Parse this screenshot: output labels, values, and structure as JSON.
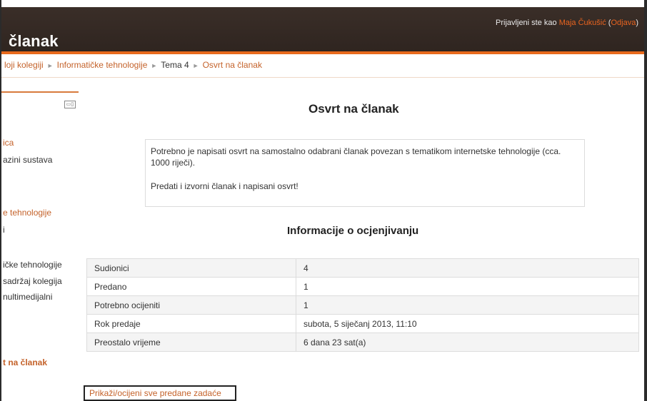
{
  "header": {
    "page_heading": "članak",
    "login_prefix": "Prijavljeni ste kao ",
    "user_name": "Maja Čukušić",
    "logout_open": " (",
    "logout_label": "Odjava",
    "logout_close": ")"
  },
  "breadcrumb": {
    "items": [
      {
        "label": "loji kolegiji"
      },
      {
        "label": "Informatičke tehnologije"
      },
      {
        "label": "Tema 4"
      },
      {
        "label": "Osvrt na članak"
      }
    ],
    "separator": "►"
  },
  "sidebar": {
    "dock_icon": "dock-icon",
    "items": [
      {
        "label": "ica"
      },
      {
        "label": "azini sustava"
      },
      {
        "label": "e tehnologije"
      },
      {
        "label": "i"
      },
      {
        "label": "ičke tehnologije"
      },
      {
        "label": "sadržaj kolegija"
      },
      {
        "label": "nultimedijalni"
      },
      {
        "label": "t na članak"
      }
    ]
  },
  "main": {
    "title": "Osvrt na članak",
    "intro": {
      "paragraph1": "Potrebno je napisati osvrt na samostalno odabrani članak povezan s tematikom internetske tehnologije (cca. 1000 riječi).",
      "paragraph2": "Predati i izvorni članak i napisani osvrt!"
    },
    "grading_title": "Informacije o ocjenjivanju",
    "grading_rows": [
      {
        "label": "Sudionici",
        "value": "4"
      },
      {
        "label": "Predano",
        "value": "1"
      },
      {
        "label": "Potrebno ocijeniti",
        "value": "1"
      },
      {
        "label": "Rok predaje",
        "value": "subota, 5 siječanj 2013, 11:10"
      },
      {
        "label": "Preostalo vrijeme",
        "value": "6 dana 23 sat(a)"
      }
    ],
    "view_all_link": "Prikaži/ocijeni sve predane zadaće"
  },
  "colors": {
    "accent": "#e86a1c",
    "link": "#c4622a",
    "header_bg": "#2f2520"
  }
}
